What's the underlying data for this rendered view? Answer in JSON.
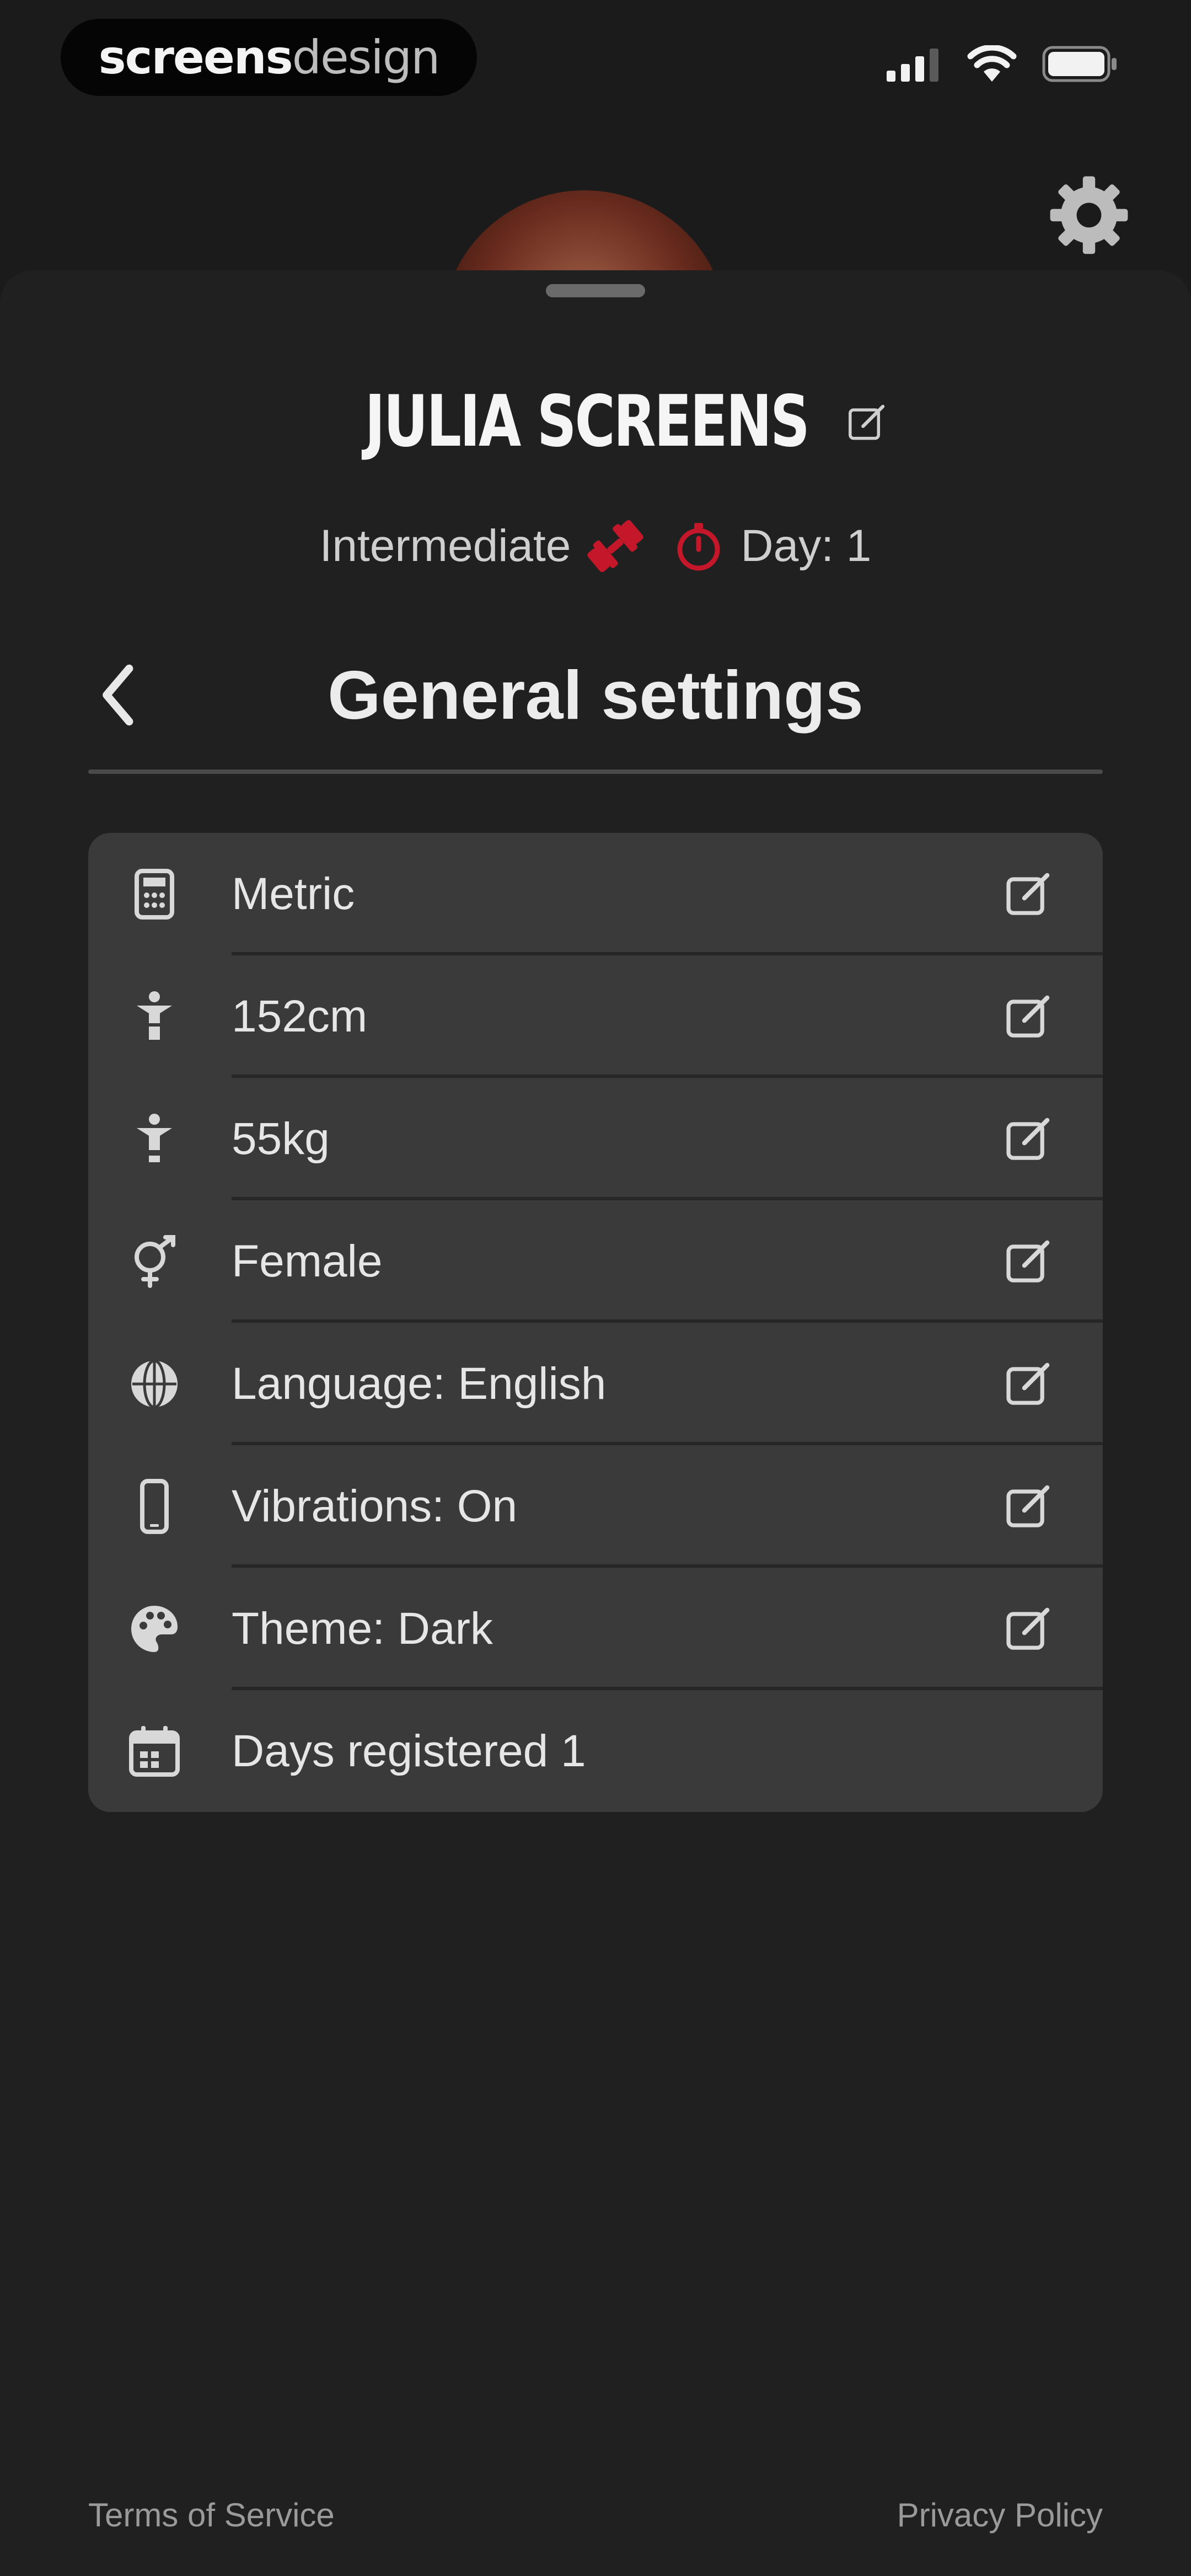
{
  "status_bar": {
    "logo_bold": "screens",
    "logo_light": "design",
    "icons": [
      "signal-icon",
      "wifi-icon",
      "battery-icon"
    ]
  },
  "profile": {
    "name": "JULIA SCREENS",
    "level": "Intermediate",
    "day": "Day: 1"
  },
  "settings": {
    "back_icon": "chevron-left-icon",
    "title": "General settings",
    "items": [
      {
        "icon": "calculator-icon",
        "label": "Metric",
        "editable": true
      },
      {
        "icon": "person-height-icon",
        "label": "152cm",
        "editable": true
      },
      {
        "icon": "person-weight-icon",
        "label": "55kg",
        "editable": true
      },
      {
        "icon": "gender-icon",
        "label": "Female",
        "editable": true
      },
      {
        "icon": "globe-icon",
        "label": "Language: English",
        "editable": true
      },
      {
        "icon": "phone-icon",
        "label": "Vibrations: On",
        "editable": true
      },
      {
        "icon": "palette-icon",
        "label": "Theme: Dark",
        "editable": true
      },
      {
        "icon": "calendar-icon",
        "label": "Days registered 1",
        "editable": false
      }
    ]
  },
  "footer": {
    "terms": "Terms of Service",
    "privacy": "Privacy Policy"
  },
  "colors": {
    "background": "#1b1b1b",
    "sheet": "#202020",
    "card": "#3a3a3a",
    "accent_red": "#c4182a",
    "text": "#e8e8e8"
  }
}
